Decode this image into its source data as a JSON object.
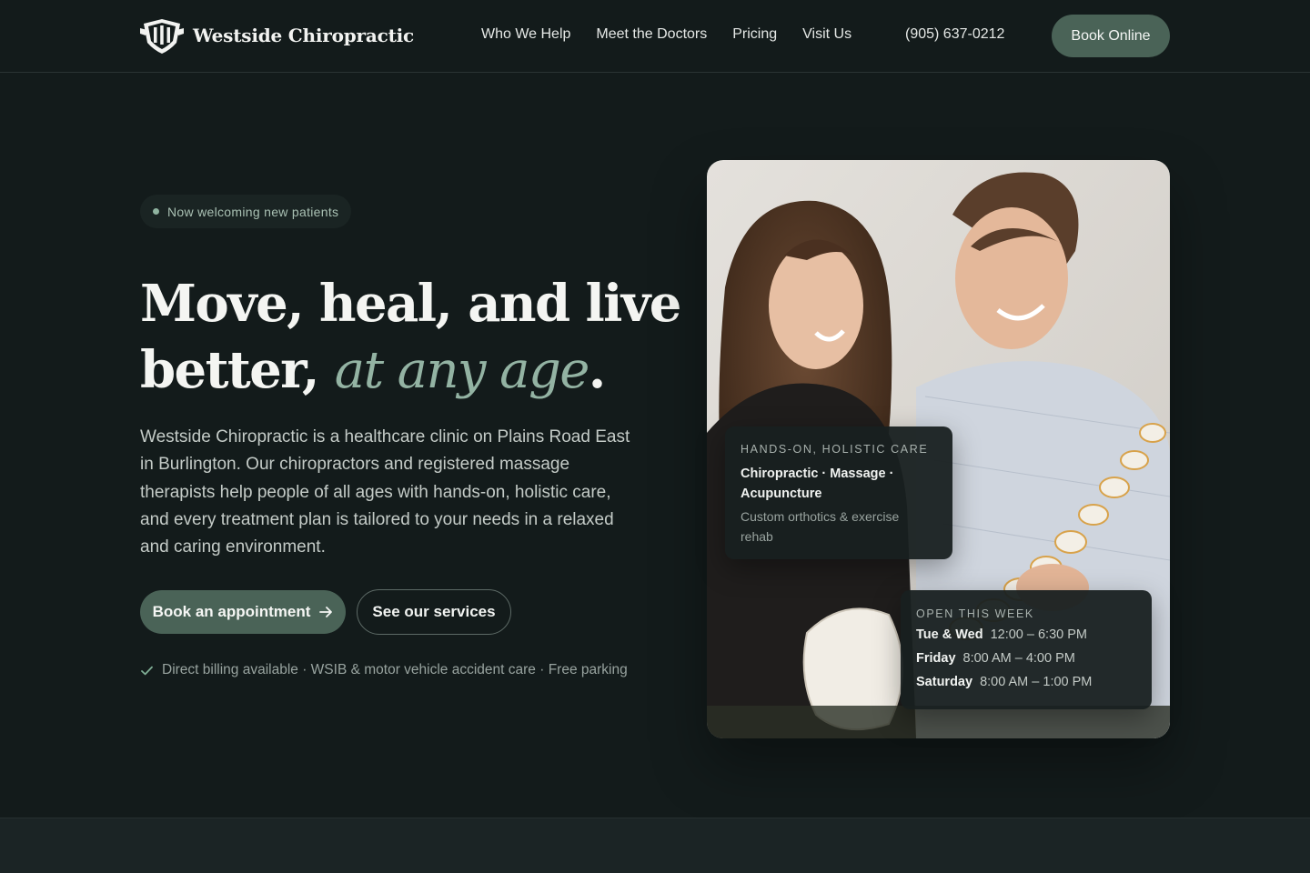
{
  "nav": {
    "brand": "Westside Chiropractic",
    "links": [
      "Who We Help",
      "Meet the Doctors",
      "Pricing",
      "Visit Us"
    ],
    "phone": "(905) 637-0212",
    "cta": "Book Online"
  },
  "hero": {
    "badge": "Now welcoming new patients",
    "headline_line1": "Move, heal, and live",
    "headline_line2_prefix": "better, ",
    "headline_accent": "at any age",
    "headline_suffix": ".",
    "description": "Westside Chiropractic is a healthcare clinic on Plains Road East in Burlington. Our chiropractors and registered massage therapists help people of all ages with hands-on, holistic care, and every treatment plan is tailored to your needs in a relaxed and caring environment.",
    "primary_button": "Book an appointment",
    "secondary_button": "See our services",
    "trust_line": "Direct billing available · WSIB & motor vehicle accident care · Free parking"
  },
  "care_card": {
    "label": "HANDS-ON, HOLISTIC CARE",
    "title": "Chiropractic · Massage · Acupuncture",
    "subtitle": "Custom orthotics & exercise rehab"
  },
  "hours_card": {
    "label": "OPEN THIS WEEK",
    "rows": [
      {
        "day": "Tue & Wed",
        "time": "12:00 – 6:30 PM"
      },
      {
        "day": "Friday",
        "time": "8:00 AM – 4:00 PM"
      },
      {
        "day": "Saturday",
        "time": "8:00 AM – 1:00 PM"
      }
    ]
  },
  "colors": {
    "background": "#131b1b",
    "accent_green": "#4a6357",
    "accent_text": "#93b3a3"
  },
  "icons": {
    "logo": "shield-crest-icon",
    "badge_dot": "status-dot-icon",
    "arrow": "arrow-right-icon",
    "check": "check-icon"
  }
}
